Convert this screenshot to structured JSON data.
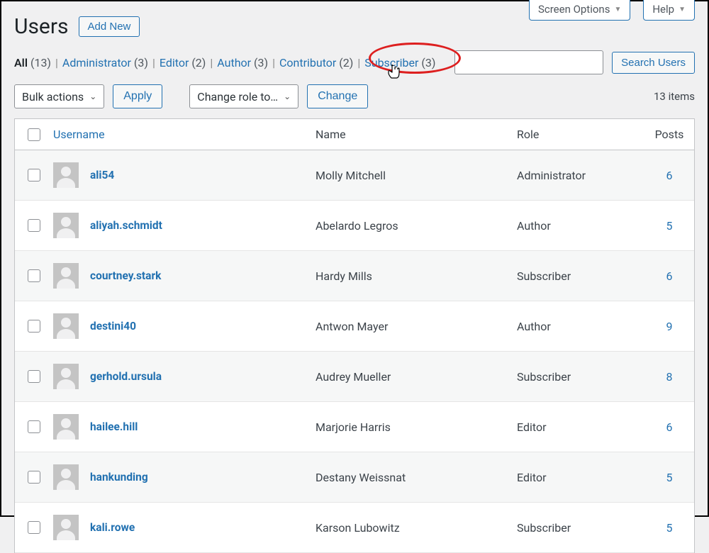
{
  "screenMeta": {
    "screenOptions": "Screen Options",
    "help": "Help"
  },
  "header": {
    "title": "Users",
    "addNew": "Add New"
  },
  "filters": {
    "all": {
      "label": "All",
      "count": "(13)"
    },
    "administrator": {
      "label": "Administrator",
      "count": "(3)"
    },
    "editor": {
      "label": "Editor",
      "count": "(2)"
    },
    "author": {
      "label": "Author",
      "count": "(3)"
    },
    "contributor": {
      "label": "Contributor",
      "count": "(2)"
    },
    "subscriber": {
      "label": "Subscriber",
      "count": "(3)"
    },
    "separator": "|"
  },
  "search": {
    "button": "Search Users"
  },
  "bulk": {
    "bulkActions": "Bulk actions",
    "apply": "Apply",
    "changeRole": "Change role to…",
    "change": "Change",
    "itemsCount": "13 items"
  },
  "columns": {
    "username": "Username",
    "name": "Name",
    "role": "Role",
    "posts": "Posts"
  },
  "rows": [
    {
      "username": "ali54",
      "name": "Molly Mitchell",
      "role": "Administrator",
      "posts": "6"
    },
    {
      "username": "aliyah.schmidt",
      "name": "Abelardo Legros",
      "role": "Author",
      "posts": "5"
    },
    {
      "username": "courtney.stark",
      "name": "Hardy Mills",
      "role": "Subscriber",
      "posts": "6"
    },
    {
      "username": "destini40",
      "name": "Antwon Mayer",
      "role": "Author",
      "posts": "9"
    },
    {
      "username": "gerhold.ursula",
      "name": "Audrey Mueller",
      "role": "Subscriber",
      "posts": "8"
    },
    {
      "username": "hailee.hill",
      "name": "Marjorie Harris",
      "role": "Editor",
      "posts": "6"
    },
    {
      "username": "hankunding",
      "name": "Destany Weissnat",
      "role": "Editor",
      "posts": "5"
    },
    {
      "username": "kali.rowe",
      "name": "Karson Lubowitz",
      "role": "Subscriber",
      "posts": "5"
    }
  ]
}
